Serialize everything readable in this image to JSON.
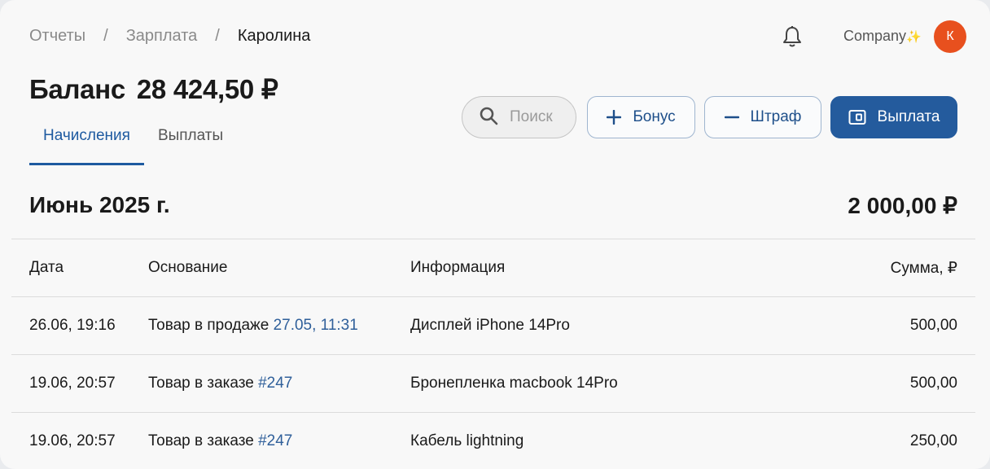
{
  "breadcrumb": [
    "Отчеты",
    "Зарплата",
    "Каролина"
  ],
  "breadcrumb_sep": "/",
  "header": {
    "company": "Company",
    "sparkle": "✨",
    "avatar_letter": "К"
  },
  "balance": {
    "label": "Баланс",
    "value": "28 424,50 ₽"
  },
  "tabs": [
    {
      "label": "Начисления",
      "active": true
    },
    {
      "label": "Выплаты",
      "active": false
    }
  ],
  "search": {
    "placeholder": "Поиск",
    "value": ""
  },
  "actions": {
    "bonus": "Бонус",
    "fine": "Штраф",
    "payout": "Выплата"
  },
  "month": {
    "title": "Июнь 2025 г.",
    "total": "2 000,00 ₽"
  },
  "table": {
    "headers": [
      "Дата",
      "Основание",
      "Информация",
      "Сумма, ₽"
    ],
    "rows": [
      {
        "date": "26.06, 19:16",
        "basis": "Товар в продаже",
        "basis_link": "27.05, 11:31",
        "info": "Дисплей iPhone 14Pro",
        "amount": "500,00"
      },
      {
        "date": "19.06, 20:57",
        "basis": "Товар в заказе",
        "basis_link": "#247",
        "info": "Бронепленка macbook 14Pro",
        "amount": "500,00"
      },
      {
        "date": "19.06, 20:57",
        "basis": "Товар в заказе",
        "basis_link": "#247",
        "info": "Кабель lightning",
        "amount": "250,00"
      }
    ]
  },
  "colors": {
    "accent": "#245b9d",
    "avatar": "#e8501e",
    "link": "#2f5f9a"
  }
}
